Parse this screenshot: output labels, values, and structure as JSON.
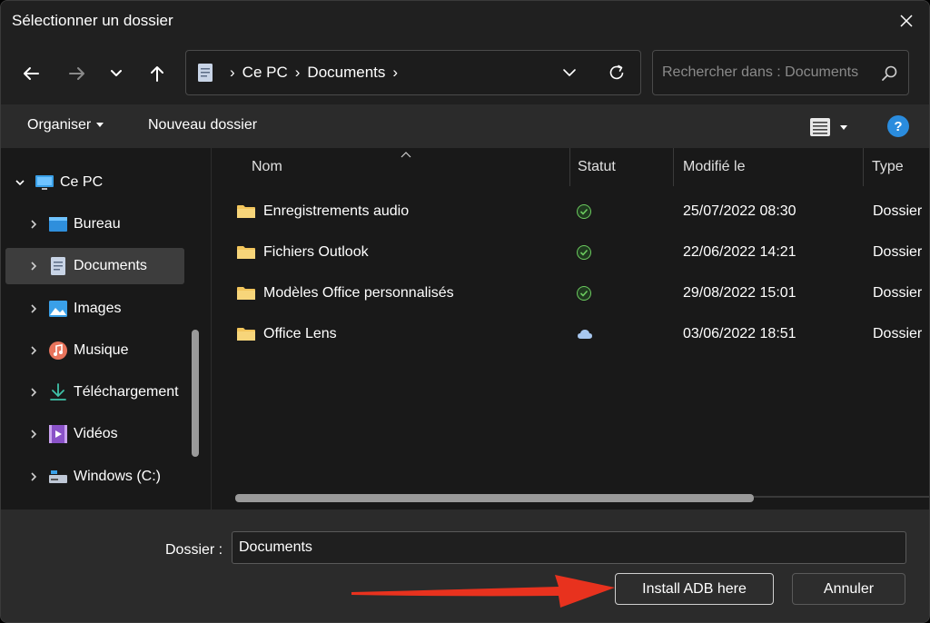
{
  "window": {
    "title": "Sélectionner un dossier"
  },
  "address": {
    "breadcrumbs": [
      "Ce PC",
      "Documents"
    ]
  },
  "search": {
    "placeholder": "Rechercher dans : Documents"
  },
  "commands": {
    "organize": "Organiser",
    "new_folder": "Nouveau dossier",
    "help": "?"
  },
  "sidebar": {
    "items": [
      {
        "label": "Ce PC",
        "icon": "computer-icon",
        "expanded": true
      },
      {
        "label": "Bureau",
        "icon": "desktop-icon"
      },
      {
        "label": "Documents",
        "icon": "documents-icon",
        "selected": true
      },
      {
        "label": "Images",
        "icon": "images-icon"
      },
      {
        "label": "Musique",
        "icon": "music-icon"
      },
      {
        "label": "Téléchargement",
        "icon": "download-icon"
      },
      {
        "label": "Vidéos",
        "icon": "videos-icon"
      },
      {
        "label": "Windows (C:)",
        "icon": "drive-icon"
      }
    ]
  },
  "table": {
    "columns": [
      "Nom",
      "Statut",
      "Modifié le",
      "Type"
    ],
    "rows": [
      {
        "name": "Enregistrements audio",
        "status": "synced",
        "modified": "25/07/2022 08:30",
        "type": "Dossier"
      },
      {
        "name": "Fichiers Outlook",
        "status": "synced",
        "modified": "22/06/2022 14:21",
        "type": "Dossier"
      },
      {
        "name": "Modèles Office personnalisés",
        "status": "synced",
        "modified": "29/08/2022 15:01",
        "type": "Dossier"
      },
      {
        "name": "Office Lens",
        "status": "cloud",
        "modified": "03/06/2022 18:51",
        "type": "Dossier"
      }
    ]
  },
  "footer": {
    "folder_label": "Dossier :",
    "folder_value": "Documents",
    "primary_button": "Install ADB here",
    "cancel_button": "Annuler"
  },
  "colors": {
    "folder": "#f2c55c",
    "synced": "#6ccb5f",
    "cloud": "#a8c8f0",
    "help": "#2a8cde",
    "arrow": "#e8321e"
  }
}
